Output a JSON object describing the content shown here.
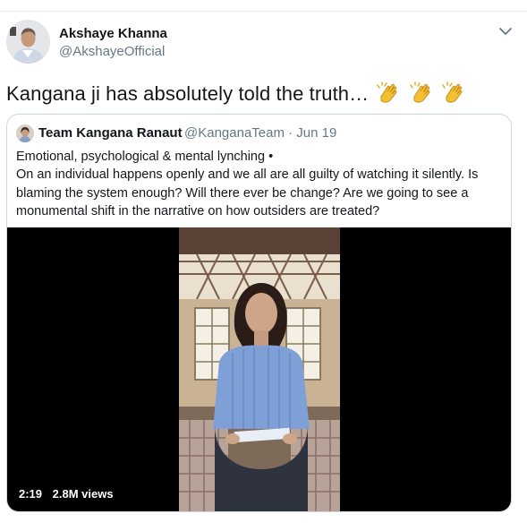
{
  "tweet": {
    "author_name": "Akshaye Khanna",
    "author_handle": "@AkshayeOfficial",
    "avatar_icon": "profile-photo",
    "more_icon": "chevron-down-icon",
    "text": "Kangana ji has absolutely told the truth…",
    "emoji": [
      "clapping-hands",
      "clapping-hands",
      "clapping-hands"
    ]
  },
  "quoted": {
    "name": "Team Kangana Ranaut",
    "handle_date": "@KanganaTeam · Jun 19",
    "lines": [
      "Emotional, psychological & mental lynching •",
      "On an individual happens openly and we all are all guilty of watching it silently. Is",
      "blaming the system enough? Will there ever be change? Are we going to see a",
      "monumental shift in the narrative on how outsiders are treated?"
    ],
    "video": {
      "duration": "2:19",
      "views": "2.8M views"
    }
  },
  "colors": {
    "text": "#14171a",
    "secondary": "#657786",
    "border": "#ccd6dd",
    "accent": "#1da1f2"
  }
}
